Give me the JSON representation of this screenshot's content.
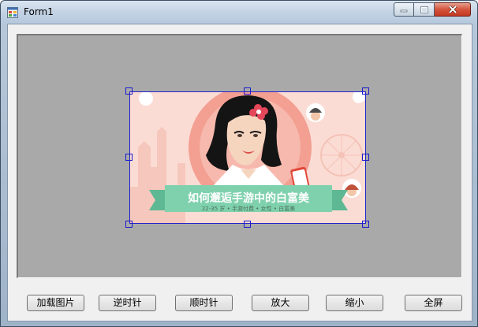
{
  "window": {
    "title": "Form1",
    "icon": "form-app-icon",
    "controls": [
      "minimize-icon",
      "maximize-icon",
      "close-icon"
    ]
  },
  "image": {
    "headline": "如何邂逅手游中的白富美",
    "subline": "22-35 岁 • 手游付费 • 女性 • 白富美"
  },
  "buttons": {
    "load": "加载图片",
    "ccw": "逆时针",
    "cw": "顺时针",
    "zoom_in": "放大",
    "zoom_out": "缩小",
    "fullscreen": "全屏"
  },
  "colors": {
    "panel_bg": "#a9a9a9",
    "selection": "#2222cc",
    "banner": "#7fd1ad",
    "image_bg": "#fbd9d2"
  }
}
